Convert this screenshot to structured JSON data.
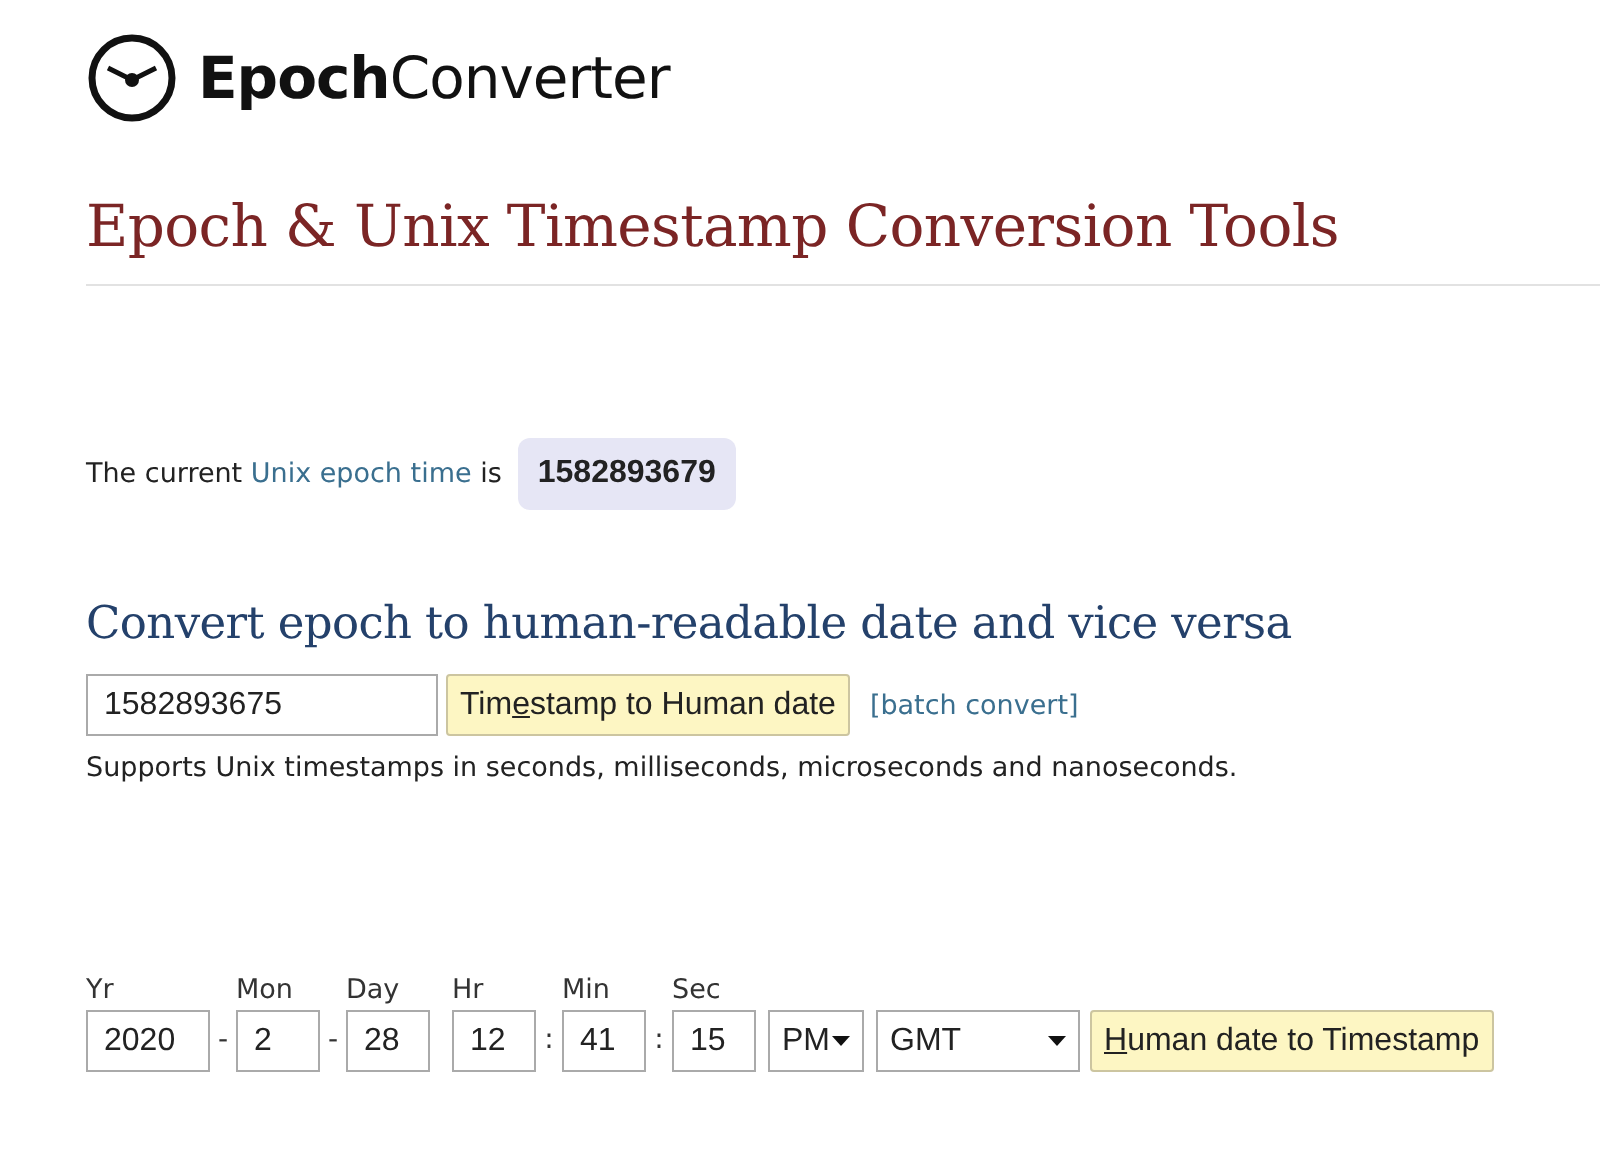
{
  "logo": {
    "bold": "Epoch",
    "light": "Converter"
  },
  "title": "Epoch & Unix Timestamp Conversion Tools",
  "current": {
    "before": "The current",
    "link": "Unix epoch time",
    "after": "is",
    "value": "1582893679"
  },
  "convert": {
    "heading": "Convert epoch to human-readable date and vice versa",
    "input": "1582893675",
    "button": {
      "before": "Tim",
      "key": "e",
      "after": "stamp to Human date"
    },
    "link": "[batch convert]",
    "note": "Supports Unix timestamps in seconds, milliseconds, microseconds and nanoseconds."
  },
  "date_fields": [
    {
      "label": "Yr",
      "value": "2020",
      "separator": "-"
    },
    {
      "label": "Mon",
      "value": "2",
      "separator": "-"
    },
    {
      "label": "Day",
      "value": "28"
    },
    {
      "label": "Hr",
      "value": "12",
      "separator": ":"
    },
    {
      "label": "Min",
      "value": "41",
      "separator": ":"
    },
    {
      "label": "Sec",
      "value": "15"
    }
  ],
  "ampm": "PM",
  "timezone": "GMT",
  "date_button": {
    "key": "H",
    "after": "uman date to Timestamp"
  }
}
